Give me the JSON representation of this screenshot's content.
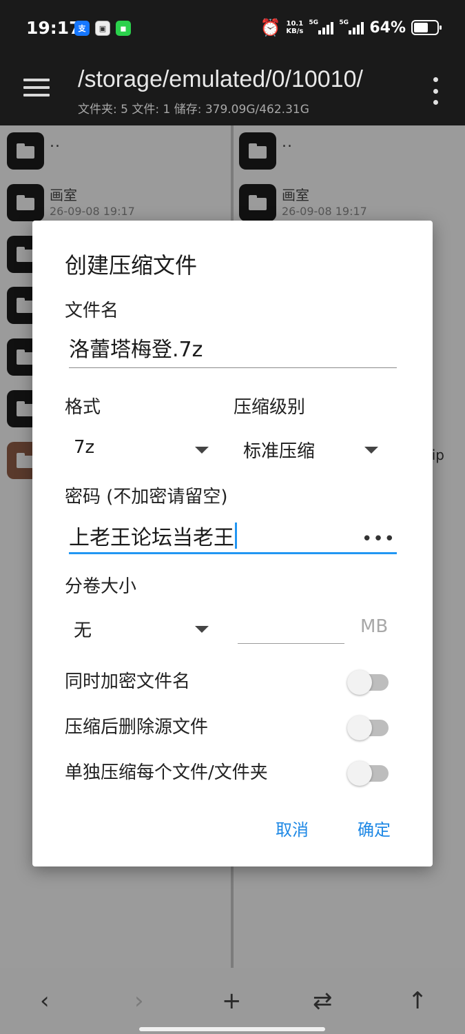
{
  "status_bar": {
    "time": "19:17",
    "net_speed_value": "10.1",
    "net_speed_unit": "KB/s",
    "signal1_label": "5G",
    "signal2_label": "5G",
    "battery": "64%",
    "battery_level": 0.64,
    "app_icons": [
      "alipay-icon",
      "app-icon",
      "iqiyi-icon"
    ]
  },
  "app_bar": {
    "path": "/storage/emulated/0/10010/",
    "info": "文件夹: 5  文件: 1  储存: 379.09G/462.31G"
  },
  "left_pane": {
    "parent": "..",
    "items": [
      {
        "name": "画室",
        "date": "26-09-08 19:17"
      }
    ]
  },
  "right_pane": {
    "parent": "..",
    "items": [
      {
        "name": "画室",
        "date": "26-09-08 19:17"
      }
    ],
    "peek_text": "ip"
  },
  "dialog": {
    "title": "创建压缩文件",
    "filename_label": "文件名",
    "filename_value": "洛蕾塔梅登.7z",
    "format_label": "格式",
    "format_value": "7z",
    "level_label": "压缩级别",
    "level_value": "标准压缩",
    "password_label": "密码 (不加密请留空)",
    "password_value": "上老王论坛当老王",
    "password_toggle": "•••",
    "volume_label": "分卷大小",
    "volume_value": "无",
    "volume_unit": "MB",
    "toggles": [
      {
        "label": "同时加密文件名",
        "on": false
      },
      {
        "label": "压缩后删除源文件",
        "on": false
      },
      {
        "label": "单独压缩每个文件/文件夹",
        "on": false
      }
    ],
    "cancel": "取消",
    "confirm": "确定"
  },
  "bottom_nav": {
    "back": "‹",
    "forward": "›",
    "add": "+",
    "swap": "⇄",
    "up": "↑"
  },
  "colors": {
    "accent": "#1e88e5",
    "focus": "#2196f3",
    "scrim_pane": "#9b9b9b",
    "bar": "#1a1a1a"
  }
}
